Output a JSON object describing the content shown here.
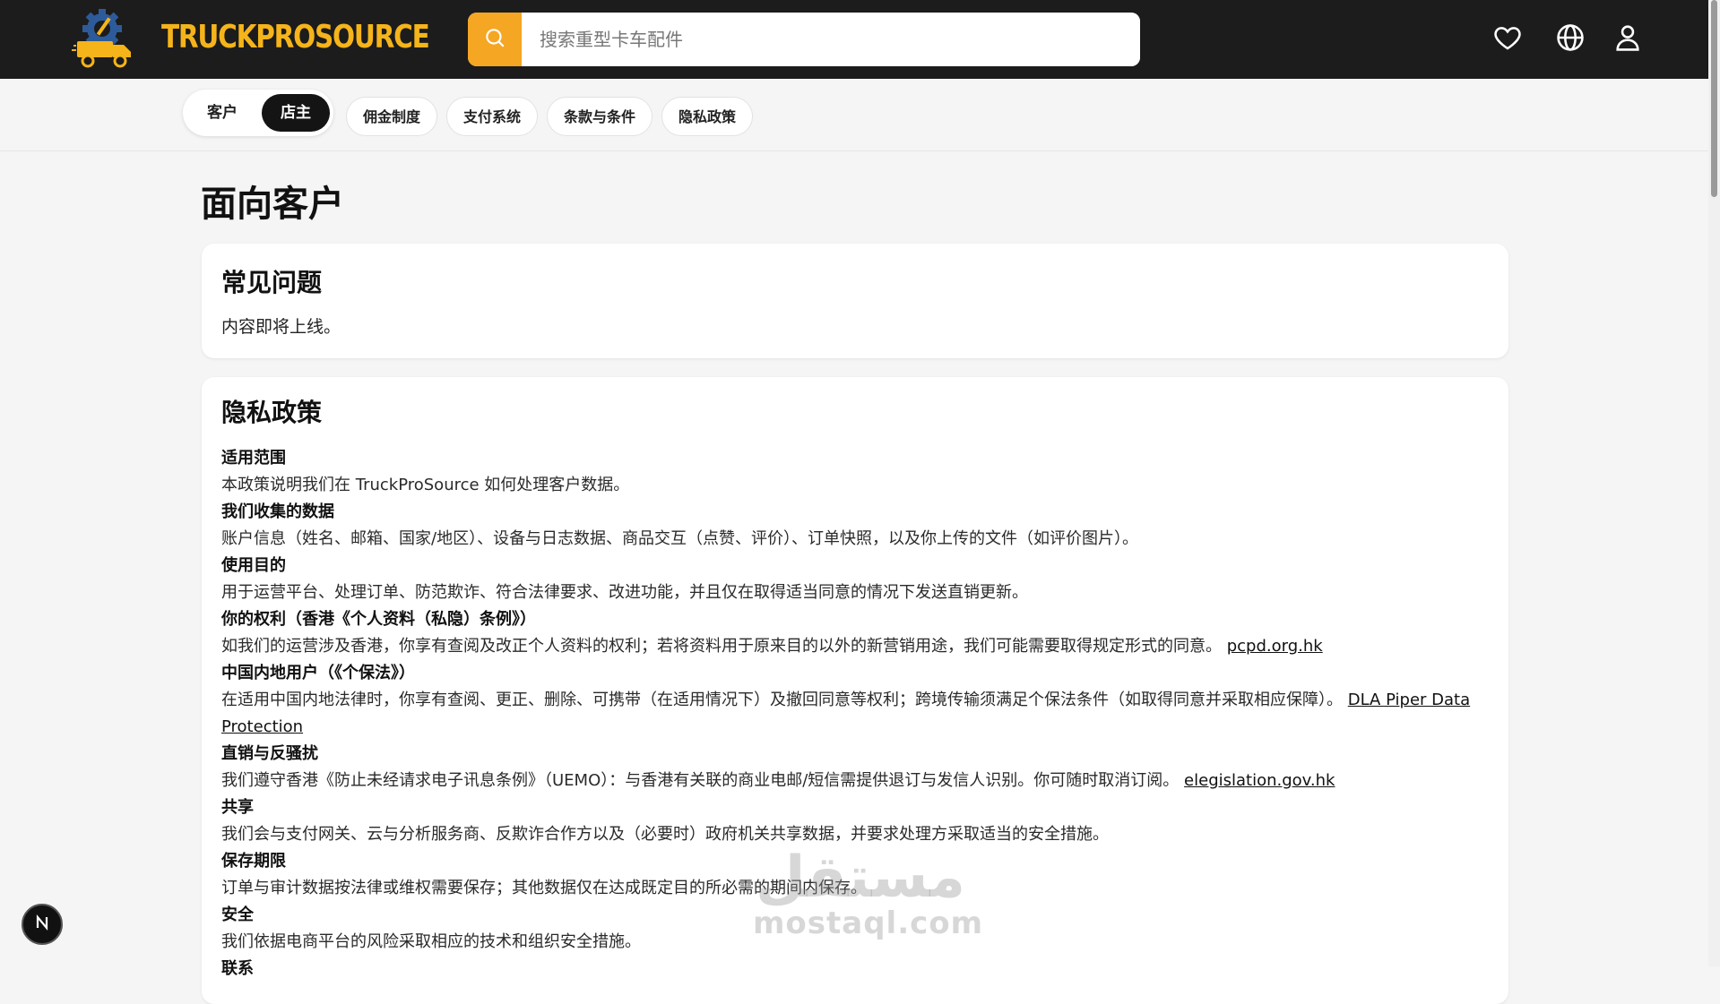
{
  "header": {
    "brand": "TRUCKPROSOURCE",
    "search_placeholder": "搜索重型卡车配件",
    "icons": [
      "search-icon",
      "heart-icon",
      "globe-icon",
      "user-icon"
    ]
  },
  "subnav": {
    "segment": [
      "客户",
      "店主"
    ],
    "active_segment": "店主",
    "tabs": [
      "佣金制度",
      "支付系统",
      "条款与条件",
      "隐私政策"
    ]
  },
  "main": {
    "page_title": "面向客户",
    "faq": {
      "title": "常见问题",
      "text": "内容即将上线。"
    },
    "privacy": {
      "title": "隐私政策",
      "sections": [
        {
          "heading": "适用范围",
          "text": "本政策说明我们在 TruckProSource 如何处理客户数据。",
          "link": ""
        },
        {
          "heading": "我们收集的数据",
          "text": "账户信息（姓名、邮箱、国家/地区）、设备与日志数据、商品交互（点赞、评价）、订单快照，以及你上传的文件（如评价图片）。",
          "link": ""
        },
        {
          "heading": "使用目的",
          "text": "用于运营平台、处理订单、防范欺诈、符合法律要求、改进功能，并且仅在取得适当同意的情况下发送直销更新。",
          "link": ""
        },
        {
          "heading": "你的权利（香港《个人资料（私隐）条例》）",
          "text": "如我们的运营涉及香港，你享有查阅及改正个人资料的权利；若将资料用于原来目的以外的新营销用途，我们可能需要取得规定形式的同意。",
          "link": "pcpd.org.hk"
        },
        {
          "heading": "中国内地用户（《个保法》）",
          "text": "在适用中国内地法律时，你享有查阅、更正、删除、可携带（在适用情况下）及撤回同意等权利；跨境传输须满足个保法条件（如取得同意并采取相应保障）。",
          "link": "DLA Piper Data Protection"
        },
        {
          "heading": "直销与反骚扰",
          "text": "我们遵守香港《防止未经请求电子讯息条例》（UEMO）：与香港有关联的商业电邮/短信需提供退订与发信人识别。你可随时取消订阅。",
          "link": "elegislation.gov.hk"
        },
        {
          "heading": "共享",
          "text": "我们会与支付网关、云与分析服务商、反欺诈合作方以及（必要时）政府机关共享数据，并要求处理方采取适当的安全措施。",
          "link": ""
        },
        {
          "heading": "保存期限",
          "text": "订单与审计数据按法律或维权需要保存；其他数据仅在达成既定目的所必需的期间内保存。",
          "link": ""
        },
        {
          "heading": "安全",
          "text": "我们依据电商平台的风险采取相应的技术和组织安全措施。",
          "link": ""
        },
        {
          "heading": "联系",
          "text": "",
          "link": ""
        }
      ]
    }
  },
  "watermark": {
    "arabic": "مستقل",
    "latin": "mostaql.com"
  },
  "fab_label": "N",
  "colors": {
    "header_bg": "#1c1c1c",
    "brand": "#f5b41a",
    "search_button": "#f5a623",
    "page_bg": "#f5f5f5"
  }
}
